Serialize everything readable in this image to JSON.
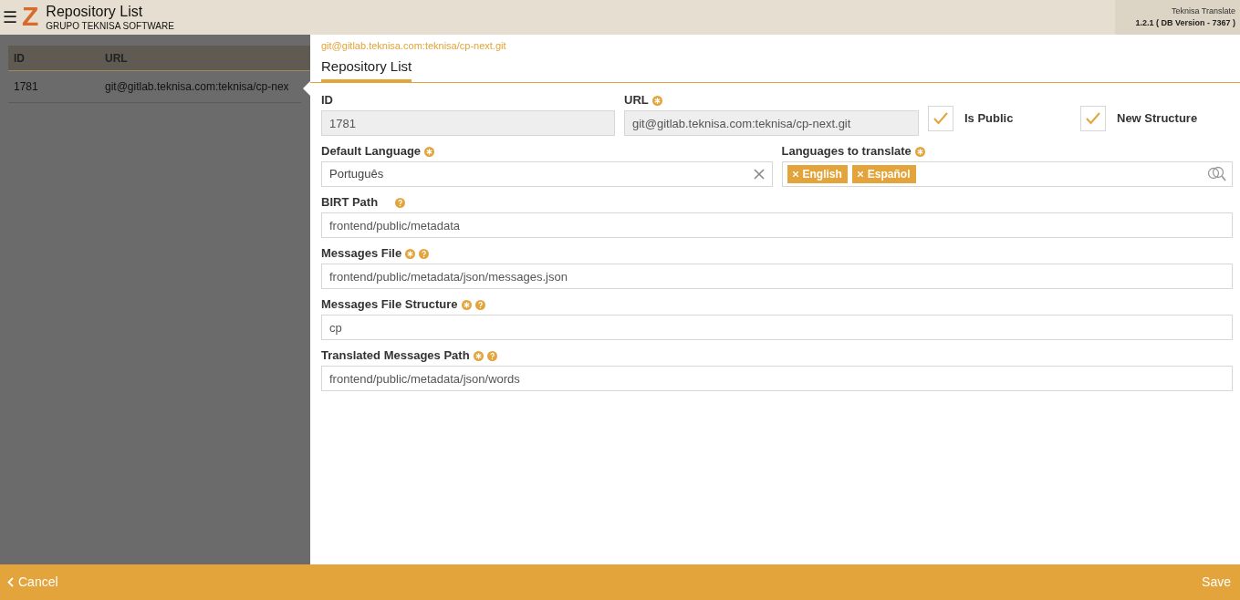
{
  "header": {
    "menu_glyph": "☰",
    "logo_letter": "Z",
    "title": "Repository List",
    "subtitle": "GRUPO TEKNISA SOFTWARE",
    "app_name": "Teknisa Translate",
    "version": "1.2.1 ( DB Version - 7367 )"
  },
  "list": {
    "columns": [
      "ID",
      "URL"
    ],
    "rows": [
      {
        "cells": [
          "1781",
          "git@gitlab.teknisa.com:teknisa/cp-nex"
        ],
        "selected": true
      }
    ]
  },
  "detail": {
    "breadcrumb": "git@gitlab.teknisa.com:teknisa/cp-next.git",
    "title": "Repository List",
    "rows": [
      [
        {
          "kind": "text",
          "label": "ID",
          "value": "1781",
          "readonly": true,
          "required": false,
          "help": false
        },
        {
          "kind": "text",
          "label": "URL",
          "value": "git@gitlab.teknisa.com:teknisa/cp-next.git",
          "readonly": true,
          "required": true,
          "help": false
        },
        {
          "kind": "checkbox",
          "label": "Is Public",
          "checked": true
        },
        {
          "kind": "checkbox",
          "label": "New Structure",
          "checked": true
        }
      ],
      [
        {
          "kind": "select",
          "label": "Default Language",
          "value": "Português",
          "required": true,
          "help": false
        },
        {
          "kind": "tags",
          "label": "Languages to translate",
          "tags": [
            "English",
            "Español"
          ],
          "required": true,
          "help": false
        }
      ],
      [
        {
          "kind": "text",
          "label": "BIRT Path",
          "value": "frontend/public/metadata",
          "readonly": false,
          "required": false,
          "help": true
        }
      ],
      [
        {
          "kind": "text",
          "label": "Messages File",
          "value": "frontend/public/metadata/json/messages.json",
          "readonly": false,
          "required": true,
          "help": true
        }
      ],
      [
        {
          "kind": "text",
          "label": "Messages File Structure",
          "value": "cp",
          "readonly": false,
          "required": true,
          "help": true
        }
      ],
      [
        {
          "kind": "text",
          "label": "Translated Messages Path",
          "value": "frontend/public/metadata/json/words",
          "readonly": false,
          "required": true,
          "help": true
        }
      ]
    ]
  },
  "footer": {
    "cancel": "Cancel",
    "save": "Save"
  }
}
